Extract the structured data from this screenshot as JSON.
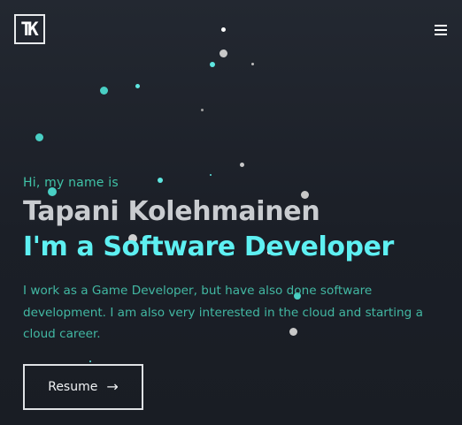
{
  "brand": {
    "logo_text": "TK"
  },
  "hero": {
    "greeting": "Hi, my name is",
    "name": "Tapani Kolehmainen",
    "tagline": "I'm a Software Developer",
    "bio": "I work as a Game Developer, but have also done software development. I am also very interested in the cloud and starting a cloud career."
  },
  "actions": {
    "resume_label": "Resume",
    "resume_icon": "arrow-right-icon"
  },
  "nav": {
    "menu_icon": "hamburger-menu-icon"
  },
  "colors": {
    "background": "#1b1f27",
    "accent_teal": "#40c4a8",
    "accent_cyan": "#5ef0f2",
    "name_text": "#c9ccd0",
    "button_border": "#dfe2e5"
  }
}
